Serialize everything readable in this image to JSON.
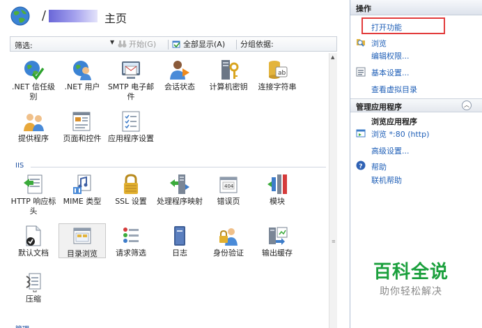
{
  "header": {
    "slash": "/",
    "title": "主页"
  },
  "filter": {
    "label": "筛选:",
    "value": "",
    "start_label": "开始(G)",
    "showall_label": "全部显示(A)",
    "group_label": "分组依据:"
  },
  "items": {
    "net_trust": ".NET 信任级别",
    "net_users": ".NET 用户",
    "smtp": "SMTP 电子邮件",
    "session": "会话状态",
    "machinekey": "计算机密钥",
    "connstr": "连接字符串",
    "providers": "提供程序",
    "pages": "页面和控件",
    "appsettings": "应用程序设置",
    "http_resp": "HTTP 响应标头",
    "mime": "MIME 类型",
    "ssl": "SSL 设置",
    "handlers": "处理程序映射",
    "errors": "错误页",
    "modules": "模块",
    "defaultdoc": "默认文档",
    "dirbrowse": "目录浏览",
    "reqfilter": "请求筛选",
    "logging": "日志",
    "auth": "身份验证",
    "outcache": "输出缓存",
    "compress": "压缩"
  },
  "groups": {
    "iis": "IIS",
    "manage": "管理"
  },
  "actions": {
    "header": "操作",
    "open_feature": "打开功能",
    "browse": "浏览",
    "edit_perms": "编辑权限...",
    "basic_settings": "基本设置...",
    "view_vdirs": "查看虚拟目录",
    "manage_app_hdr": "管理应用程序",
    "browse_app": "浏览应用程序",
    "browse_port": "浏览 *:80 (http)",
    "advanced": "高级设置...",
    "help": "帮助",
    "online_help": "联机帮助"
  },
  "watermark": {
    "big": "百科全说",
    "small": "助你轻松解决"
  }
}
